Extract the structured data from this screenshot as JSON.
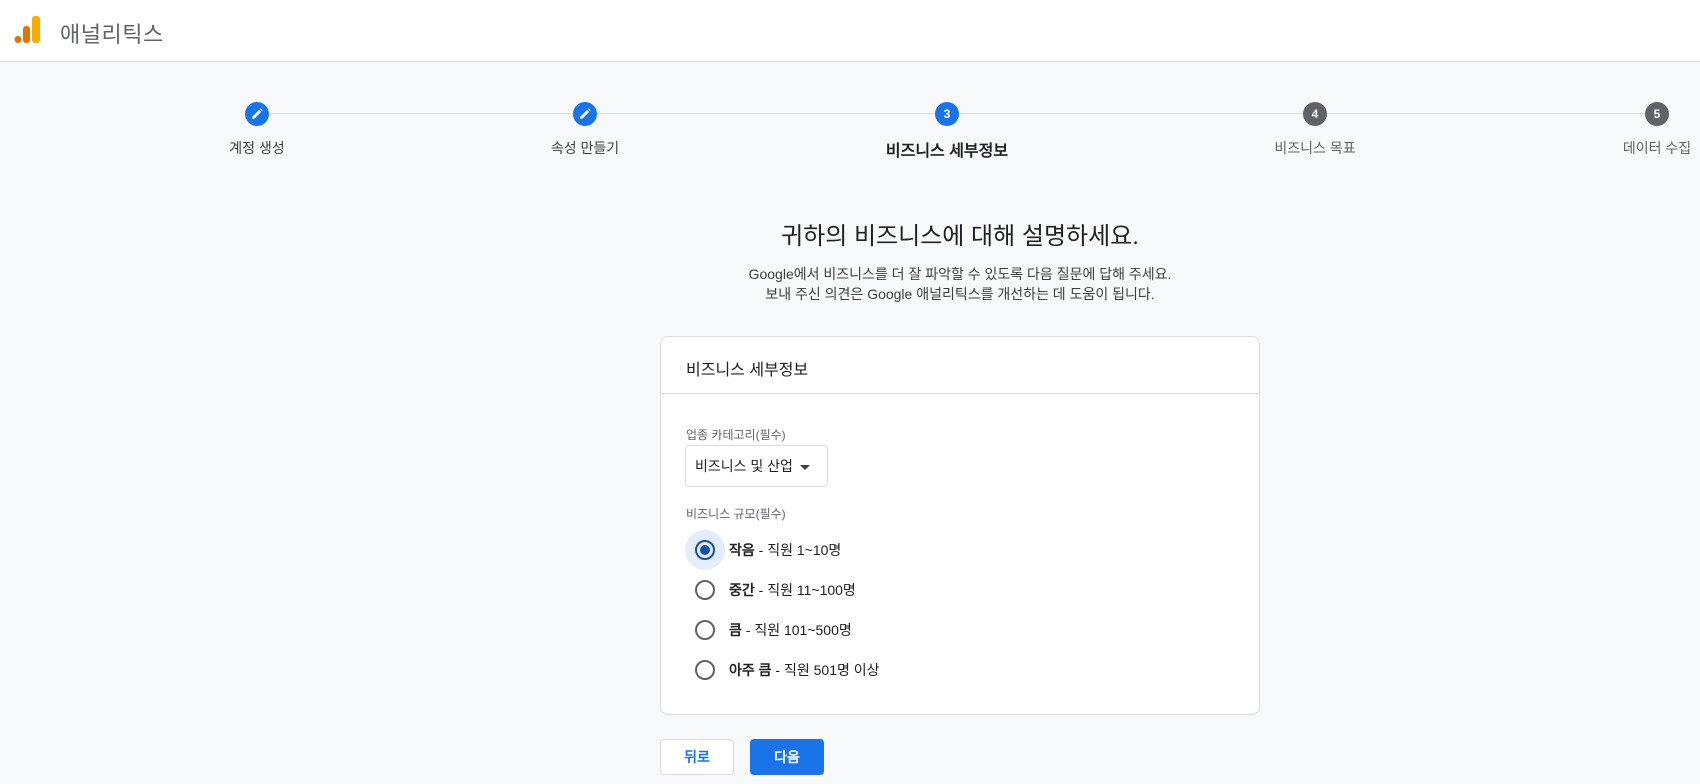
{
  "app": {
    "title": "애널리틱스",
    "logo_colors": [
      "#e37400",
      "#f9ab00"
    ]
  },
  "stepper": {
    "steps": [
      {
        "label": "계정 생성",
        "state": "done",
        "icon": "pencil-icon"
      },
      {
        "label": "속성 만들기",
        "state": "done",
        "icon": "pencil-icon"
      },
      {
        "label": "비즈니스 세부정보",
        "state": "active",
        "number": "3"
      },
      {
        "label": "비즈니스 목표",
        "state": "todo",
        "number": "4"
      },
      {
        "label": "데이터 수집",
        "state": "todo",
        "number": "5"
      }
    ]
  },
  "main": {
    "headline": "귀하의 비즈니스에 대해 설명하세요.",
    "sub_line1": "Google에서 비즈니스를 더 잘 파악할 수 있도록 다음 질문에 답해 주세요.",
    "sub_line2": "보내 주신 의견은 Google 애널리틱스를 개선하는 데 도움이 됩니다."
  },
  "card": {
    "title": "비즈니스 세부정보",
    "industry_label": "업종 카테고리(필수)",
    "industry_value": "비즈니스 및 산업",
    "size_label": "비즈니스 규모(필수)",
    "size_options": [
      {
        "bold": "작음",
        "rest": " - 직원 1~10명",
        "checked": true
      },
      {
        "bold": "중간",
        "rest": " - 직원 11~100명",
        "checked": false
      },
      {
        "bold": "큼",
        "rest": " - 직원 101~500명",
        "checked": false
      },
      {
        "bold": "아주 큼",
        "rest": " - 직원 501명 이상",
        "checked": false
      }
    ]
  },
  "buttons": {
    "back": "뒤로",
    "next": "다음"
  },
  "colors": {
    "primary": "#1a73e8",
    "radio_checked": "#174ea6",
    "pending_step": "#5f6368"
  }
}
